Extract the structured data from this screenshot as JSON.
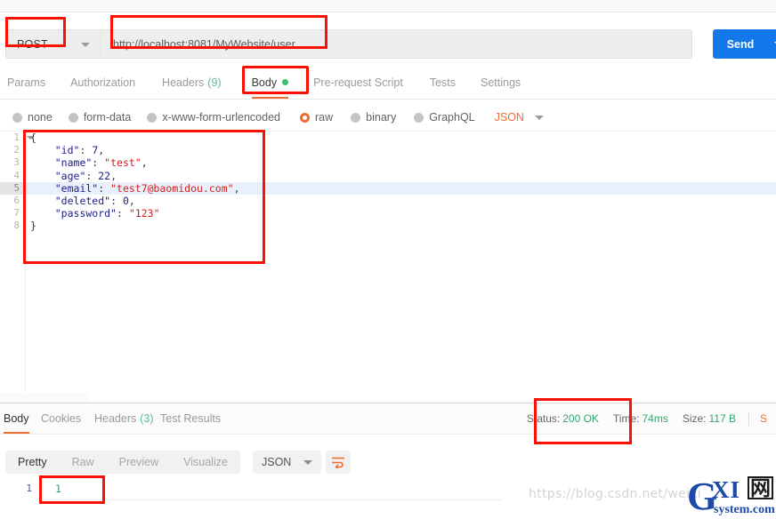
{
  "request": {
    "method": "POST",
    "url": "http://localhost:8081/MyWebsite/user",
    "send_label": "Send",
    "tabs": [
      {
        "label": "Params",
        "count": "",
        "active": false
      },
      {
        "label": "Authorization",
        "count": "",
        "active": false
      },
      {
        "label": "Headers",
        "count": "(9)",
        "active": false
      },
      {
        "label": "Body",
        "count": "",
        "active": true
      },
      {
        "label": "Pre-request Script",
        "count": "",
        "active": false
      },
      {
        "label": "Tests",
        "count": "",
        "active": false
      },
      {
        "label": "Settings",
        "count": "",
        "active": false
      }
    ],
    "body_types": [
      {
        "label": "none",
        "selected": false
      },
      {
        "label": "form-data",
        "selected": false
      },
      {
        "label": "x-www-form-urlencoded",
        "selected": false
      },
      {
        "label": "raw",
        "selected": true
      },
      {
        "label": "binary",
        "selected": false
      },
      {
        "label": "GraphQL",
        "selected": false
      }
    ],
    "raw_format": "JSON",
    "editor": {
      "line_numbers": [
        "1",
        "2",
        "3",
        "4",
        "5",
        "6",
        "7",
        "8"
      ],
      "highlighted_line": 5,
      "lines": [
        "{",
        "    \"id\": 7,",
        "    \"name\": \"test\",",
        "    \"age\": 22,",
        "    \"email\": \"test7@baomidou.com\",",
        "    \"deleted\": 0,",
        "    \"password\": \"123\"",
        "}"
      ],
      "json_object": {
        "id": 7,
        "name": "test",
        "age": 22,
        "email": "test7@baomidou.com",
        "deleted": 0,
        "password": "123"
      }
    }
  },
  "response": {
    "tabs": [
      {
        "label": "Body",
        "count": "",
        "active": true
      },
      {
        "label": "Cookies",
        "count": "",
        "active": false
      },
      {
        "label": "Headers",
        "count": "(3)",
        "active": false
      },
      {
        "label": "Test Results",
        "count": "",
        "active": false
      }
    ],
    "status": {
      "label": "Status:",
      "value": "200 OK"
    },
    "time": {
      "label": "Time:",
      "value": "74ms"
    },
    "size": {
      "label": "Size:",
      "value": "117 B"
    },
    "save_label": "S",
    "view_modes": [
      {
        "label": "Pretty",
        "active": true
      },
      {
        "label": "Raw",
        "active": false
      },
      {
        "label": "Preview",
        "active": false
      },
      {
        "label": "Visualize",
        "active": false
      }
    ],
    "format": "JSON",
    "body": {
      "line_numbers": [
        "1"
      ],
      "lines": [
        "1"
      ]
    }
  },
  "watermark": {
    "blog_url": "https://blog.csdn.net/weixi",
    "logo_g": "G",
    "logo_xi": "XI",
    "logo_cn": "网",
    "logo_sys": "system.com"
  },
  "colors": {
    "accent_orange": "#ef6c33",
    "send_blue": "#1379eb",
    "status_green": "#2fa86e",
    "annotation_red": "#fc1005",
    "json_key": "#20208a",
    "json_string": "#d01f1f"
  }
}
